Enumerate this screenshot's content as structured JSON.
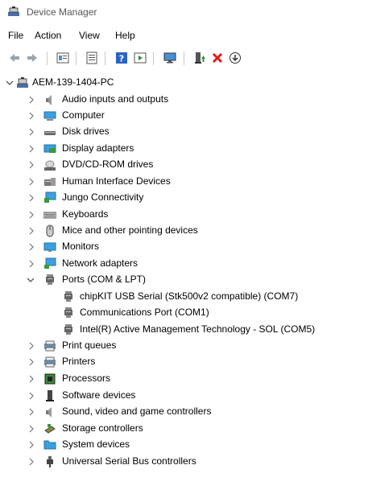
{
  "window": {
    "title": "Device Manager",
    "icon": "device-manager-icon"
  },
  "menu": [
    "File",
    "Action",
    "View",
    "Help"
  ],
  "toolbar": {
    "buttons": [
      "back-arrow-icon",
      "forward-arrow-icon",
      "properties-icon",
      "view-icon",
      "help-icon",
      "run-icon",
      "monitor-icon",
      "update-driver-icon",
      "uninstall-icon",
      "scan-hardware-icon"
    ]
  },
  "tree": {
    "root": "AEM-139-1404-PC",
    "categories": [
      {
        "label": "Audio inputs and outputs",
        "icon": "speaker-icon",
        "expanded": false
      },
      {
        "label": "Computer",
        "icon": "computer-icon",
        "expanded": false
      },
      {
        "label": "Disk drives",
        "icon": "disk-drive-icon",
        "expanded": false
      },
      {
        "label": "Display adapters",
        "icon": "display-adapter-icon",
        "expanded": false
      },
      {
        "label": "DVD/CD-ROM drives",
        "icon": "dvd-drive-icon",
        "expanded": false
      },
      {
        "label": "Human Interface Devices",
        "icon": "hid-icon",
        "expanded": false
      },
      {
        "label": "Jungo Connectivity",
        "icon": "jungo-icon",
        "expanded": false
      },
      {
        "label": "Keyboards",
        "icon": "keyboard-icon",
        "expanded": false
      },
      {
        "label": "Mice and other pointing devices",
        "icon": "mouse-icon",
        "expanded": false
      },
      {
        "label": "Monitors",
        "icon": "monitor-icon",
        "expanded": false
      },
      {
        "label": "Network adapters",
        "icon": "network-adapter-icon",
        "expanded": false
      },
      {
        "label": "Ports (COM & LPT)",
        "icon": "port-icon",
        "expanded": true,
        "children": [
          "chipKIT USB Serial (Stk500v2 compatible) (COM7)",
          "Communications Port (COM1)",
          "Intel(R) Active Management Technology - SOL (COM5)"
        ]
      },
      {
        "label": "Print queues",
        "icon": "print-queue-icon",
        "expanded": false
      },
      {
        "label": "Printers",
        "icon": "printer-icon",
        "expanded": false
      },
      {
        "label": "Processors",
        "icon": "processor-icon",
        "expanded": false
      },
      {
        "label": "Software devices",
        "icon": "software-device-icon",
        "expanded": false
      },
      {
        "label": "Sound, video and game controllers",
        "icon": "sound-icon",
        "expanded": false
      },
      {
        "label": "Storage controllers",
        "icon": "storage-controller-icon",
        "expanded": false
      },
      {
        "label": "System devices",
        "icon": "system-device-icon",
        "expanded": false
      },
      {
        "label": "Universal Serial Bus controllers",
        "icon": "usb-icon",
        "expanded": false
      }
    ]
  }
}
